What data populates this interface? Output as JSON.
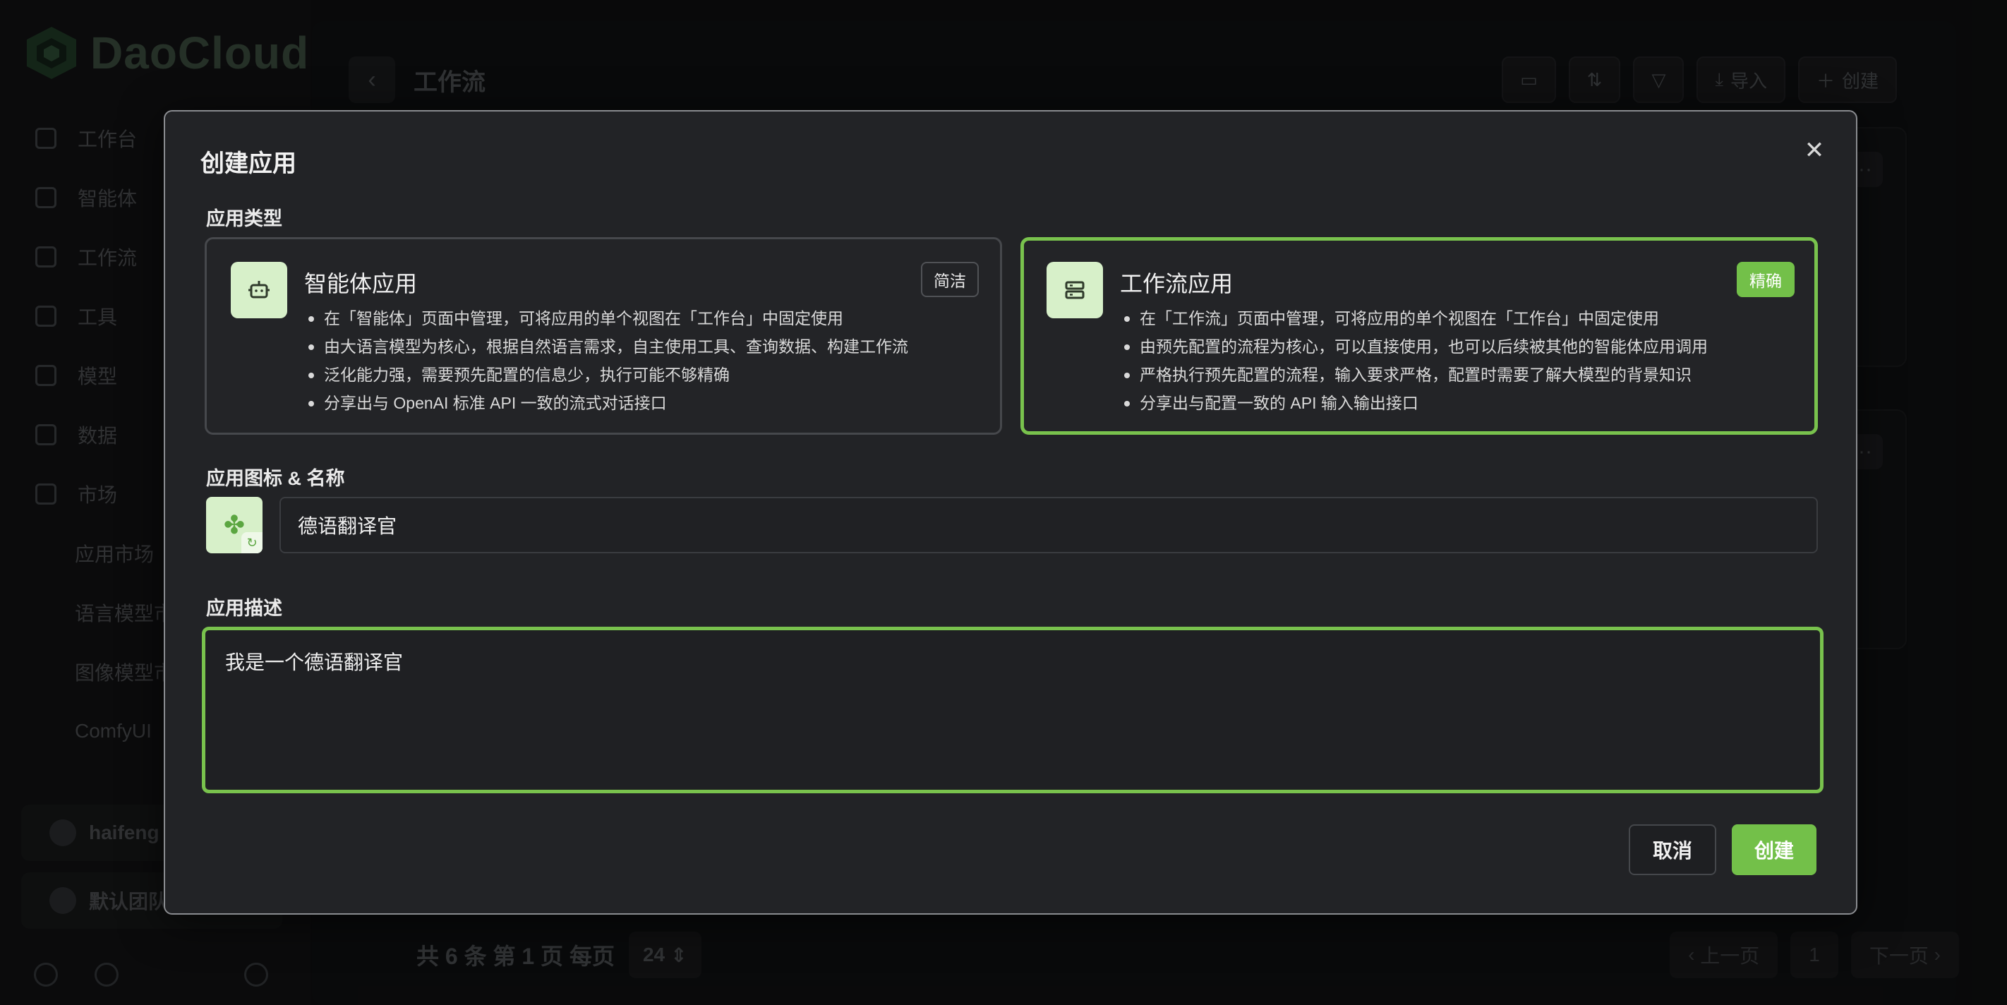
{
  "brand": {
    "logo_text": "DaoCloud"
  },
  "sidebar": {
    "items": [
      {
        "label": "工作台",
        "icon": "rocket-icon"
      },
      {
        "label": "智能体",
        "icon": "robot-icon"
      },
      {
        "label": "工作流",
        "icon": "workflow-icon"
      },
      {
        "label": "工具",
        "icon": "calculator-icon"
      },
      {
        "label": "模型",
        "icon": "cube-icon"
      },
      {
        "label": "数据",
        "icon": "database-icon"
      },
      {
        "label": "市场",
        "icon": "cart-icon"
      }
    ],
    "sub_items": [
      {
        "label": "应用市场"
      },
      {
        "label": "语言模型市"
      },
      {
        "label": "图像模型市"
      },
      {
        "label": "ComfyUI"
      }
    ],
    "user_name": "haifeng",
    "team_name": "默认团队"
  },
  "main": {
    "title": "工作流",
    "toolbar": {
      "import_label": "导入",
      "create_label": "创建"
    },
    "pagination": {
      "summary": "共 6 条 第 1 页 每页",
      "page_size": "24",
      "prev_label": "上一页",
      "current_page": "1",
      "next_label": "下一页"
    }
  },
  "dialog": {
    "title": "创建应用",
    "type_section_label": "应用类型",
    "types": [
      {
        "name": "智能体应用",
        "badge": "简洁",
        "icon": "robot-icon",
        "selected": false,
        "points": [
          "在「智能体」页面中管理，可将应用的单个视图在「工作台」中固定使用",
          "由大语言模型为核心，根据自然语言需求，自主使用工具、查询数据、构建工作流",
          "泛化能力强，需要预先配置的信息少，执行可能不够精确",
          "分享出与 OpenAI 标准 API 一致的流式对话接口"
        ]
      },
      {
        "name": "工作流应用",
        "badge": "精确",
        "icon": "workflow-icon",
        "selected": true,
        "points": [
          "在「工作流」页面中管理，可将应用的单个视图在「工作台」中固定使用",
          "由预先配置的流程为核心，可以直接使用，也可以后续被其他的智能体应用调用",
          "严格执行预先配置的流程，输入要求严格，配置时需要了解大模型的背景知识",
          "分享出与配置一致的 API 输入输出接口"
        ]
      }
    ],
    "icon_name_label": "应用图标 & 名称",
    "app_icon": "clover-icon",
    "name_value": "德语翻译官",
    "description_label": "应用描述",
    "description_value": "我是一个德语翻译官",
    "cancel_label": "取消",
    "create_label": "创建"
  },
  "colors": {
    "accent_green": "#73c049",
    "icon_bg": "#d7f0c9",
    "dialog_bg": "#222326"
  }
}
